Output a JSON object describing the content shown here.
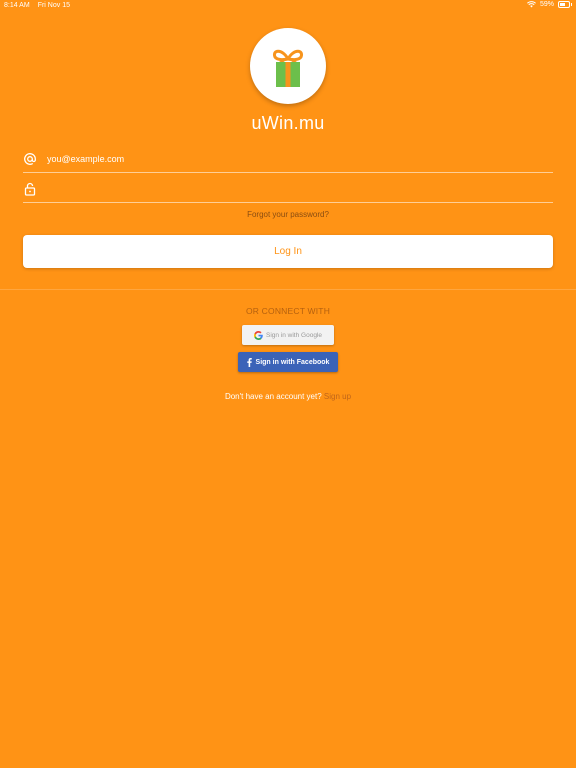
{
  "status_bar": {
    "time": "8:14 AM",
    "date": "Fri Nov 15",
    "battery": "59%",
    "battery_level": 0.59
  },
  "app": {
    "title": "uWin.mu"
  },
  "login_form": {
    "email_placeholder": "you@example.com",
    "password_placeholder": "",
    "forgot_label": "Forgot your password?",
    "login_label": "Log In"
  },
  "social": {
    "connect_label": "OR CONNECT WITH",
    "google_label": "Sign in with Google",
    "facebook_label": "Sign in with Facebook"
  },
  "signup": {
    "prompt": "Don't have an account yet?",
    "link_label": "Sign up"
  },
  "colors": {
    "background": "#FF9315",
    "facebook": "#3b63b8",
    "gift_box": "#6CBF4B",
    "ribbon": "#F7941D"
  },
  "icons": [
    "wifi-icon",
    "battery-icon",
    "gift-icon",
    "at-icon",
    "lock-icon",
    "google-icon",
    "facebook-icon"
  ]
}
